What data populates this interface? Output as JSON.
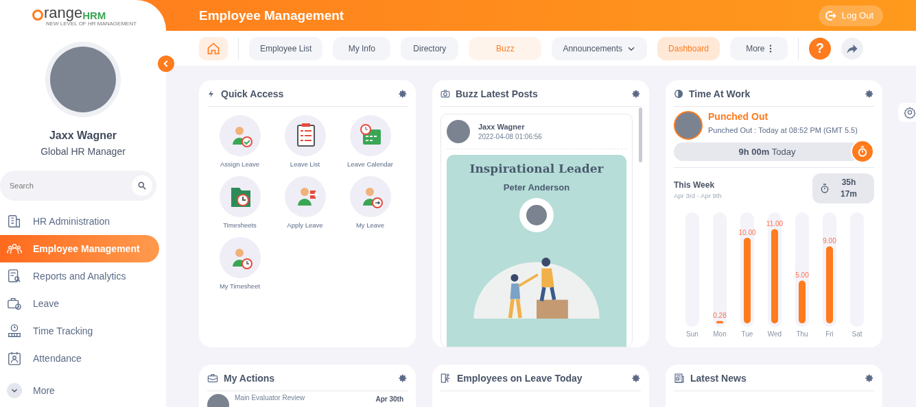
{
  "sidebar": {
    "logo": {
      "word": "range",
      "brand": "HRM",
      "tagline": "NEW LEVEL OF HR MANAGEMENT"
    },
    "user": {
      "name": "Jaxx Wagner",
      "role": "Global HR Manager"
    },
    "search": {
      "placeholder": "Search"
    },
    "items": [
      {
        "label": "HR Administration",
        "kind": "building",
        "selected": false
      },
      {
        "label": "Employee Management",
        "kind": "people",
        "selected": true
      },
      {
        "label": "Reports and Analytics",
        "kind": "report",
        "selected": false
      },
      {
        "label": "Leave",
        "kind": "leave",
        "selected": false
      },
      {
        "label": "Time Tracking",
        "kind": "clock",
        "selected": false
      },
      {
        "label": "Attendance",
        "kind": "calendar",
        "selected": false
      }
    ],
    "more": "More"
  },
  "header": {
    "title": "Employee Management",
    "logout": "Log Out"
  },
  "nav": {
    "tabs": [
      {
        "label": "Employee List",
        "selected": false,
        "hovered": false,
        "kind": "plain"
      },
      {
        "label": "My Info",
        "selected": false,
        "hovered": false,
        "kind": "plain"
      },
      {
        "label": "Directory",
        "selected": false,
        "hovered": false,
        "kind": "plain"
      },
      {
        "label": "Buzz",
        "selected": false,
        "hovered": true,
        "kind": "plain"
      },
      {
        "label": "Announcements",
        "selected": false,
        "hovered": false,
        "kind": "dropdown"
      },
      {
        "label": "Dashboard",
        "selected": true,
        "hovered": false,
        "kind": "plain"
      },
      {
        "label": "More",
        "selected": false,
        "hovered": false,
        "kind": "menu"
      }
    ],
    "help": "?"
  },
  "quick_access": {
    "title": "Quick Access",
    "items": [
      {
        "label": "Assign Leave",
        "kind": "assign"
      },
      {
        "label": "Leave List",
        "kind": "list"
      },
      {
        "label": "Leave Calendar",
        "kind": "calendar"
      },
      {
        "label": "Timesheets",
        "kind": "timesheet"
      },
      {
        "label": "Apply Leave",
        "kind": "apply"
      },
      {
        "label": "My Leave",
        "kind": "myleave"
      },
      {
        "label": "My Timesheet",
        "kind": "mytime"
      }
    ]
  },
  "buzz": {
    "title": "Buzz Latest Posts",
    "post": {
      "author": "Jaxx Wagner",
      "date": "2022-04-08 01:06:56",
      "heading": "Inspirational Leader",
      "person": "Peter Anderson"
    }
  },
  "time_at_work": {
    "title": "Time At Work",
    "status": "Punched Out",
    "detail": "Punched Out : Today at 08:52 PM (GMT 5.5)",
    "today": "**9h 00m** Today",
    "week_label": "This Week",
    "week_range": "Apr 3rd - Apr 9th",
    "week_total": "35h 17m",
    "chart_data": {
      "type": "bar",
      "categories": [
        "Sun",
        "Mon",
        "Tue",
        "Wed",
        "Thu",
        "Fri",
        "Sat"
      ],
      "values": [
        null,
        0.28,
        10,
        11,
        5,
        9,
        null
      ],
      "data_labels": true,
      "value_labels": [
        null,
        "0.28",
        "10.00",
        "11.00",
        "5.00",
        "9.00",
        null
      ]
    }
  },
  "my_actions": {
    "title": "My Actions",
    "rows": [
      {
        "text": "Main Evaluator Review",
        "date": "Apr 30th"
      }
    ]
  },
  "leave_today": {
    "title": "Employees on Leave Today"
  },
  "latest_news": {
    "title": "Latest News"
  }
}
